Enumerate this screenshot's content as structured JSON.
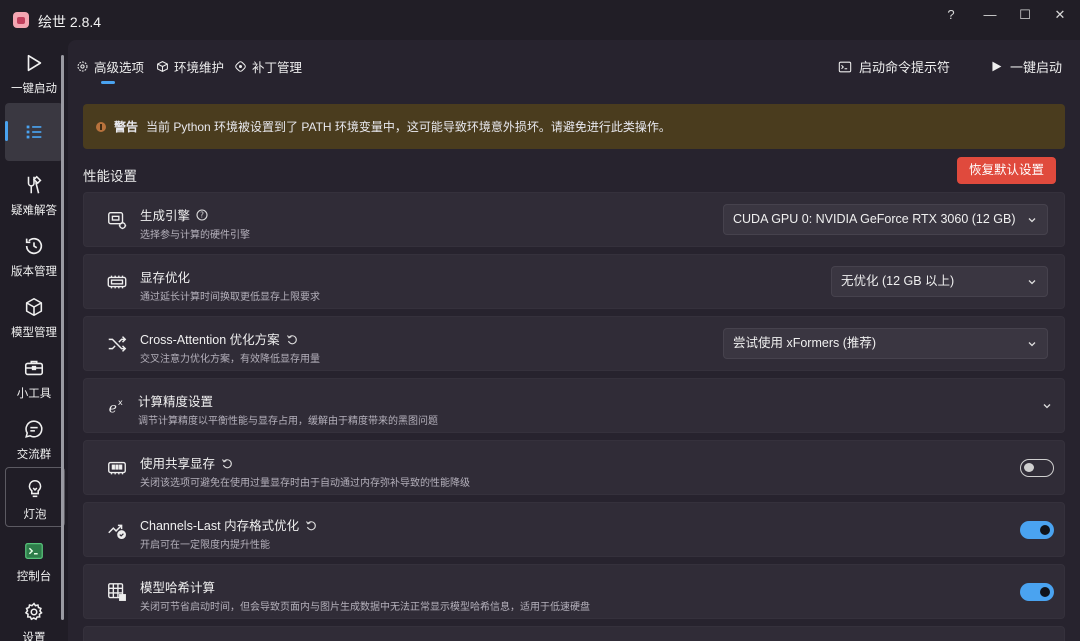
{
  "app": {
    "title": "绘世 2.8.4"
  },
  "window_controls": {
    "help": "?",
    "minimize": "—",
    "maximize": "☐",
    "close": "✕"
  },
  "sidebar": {
    "items": [
      {
        "label": "一键启动",
        "icon": "play-icon"
      },
      {
        "label": "",
        "icon": "list-icon"
      },
      {
        "label": "疑难解答",
        "icon": "tools-icon"
      },
      {
        "label": "版本管理",
        "icon": "history-icon"
      },
      {
        "label": "模型管理",
        "icon": "cube-icon"
      },
      {
        "label": "小工具",
        "icon": "toolbox-icon"
      },
      {
        "label": "交流群",
        "icon": "chat-icon"
      },
      {
        "label": "灯泡",
        "icon": "bulb-icon"
      },
      {
        "label": "控制台",
        "icon": "console-icon"
      },
      {
        "label": "设置",
        "icon": "gear-icon"
      }
    ]
  },
  "tabs": [
    {
      "label": "高级选项",
      "icon": "gear-icon"
    },
    {
      "label": "环境维护",
      "icon": "box-icon"
    },
    {
      "label": "补丁管理",
      "icon": "patch-icon"
    }
  ],
  "actions": {
    "console_label": "启动命令提示符",
    "launch_label": "一键启动"
  },
  "warning": {
    "label": "警告",
    "text": "当前 Python 环境被设置到了 PATH 环境变量中，这可能导致环境意外损坏。请避免进行此类操作。"
  },
  "section": {
    "title": "性能设置",
    "reset_label": "恢复默认设置"
  },
  "settings": [
    {
      "title": "生成引擎",
      "desc": "选择参与计算的硬件引擎",
      "control": "select",
      "value": "CUDA GPU 0: NVIDIA GeForce RTX 3060 (12 GB)",
      "icon": "engine-icon"
    },
    {
      "title": "显存优化",
      "desc": "通过延长计算时间换取更低显存上限要求",
      "control": "select",
      "value": "无优化 (12 GB 以上)",
      "icon": "memory-icon"
    },
    {
      "title": "Cross-Attention 优化方案",
      "desc": "交叉注意力优化方案，有效降低显存用量",
      "control": "select",
      "value": "尝试使用 xFormers (推荐)",
      "icon": "shuffle-icon"
    },
    {
      "title": "计算精度设置",
      "desc": "调节计算精度以平衡性能与显存占用，缓解由于精度带来的黑图问题",
      "control": "expand",
      "icon": "exponent-icon"
    },
    {
      "title": "使用共享显存",
      "desc": "关闭该选项可避免在使用过量显存时由于自动通过内存弥补导致的性能降级",
      "control": "toggle",
      "on": false,
      "icon": "ram-icon"
    },
    {
      "title": "Channels-Last 内存格式优化",
      "desc": "开启可在一定限度内提升性能",
      "control": "toggle",
      "on": true,
      "icon": "trend-icon"
    },
    {
      "title": "模型哈希计算",
      "desc": "关闭可节省启动时间，但会导致页面内与图片生成数据中无法正常显示模型哈希信息，适用于低速硬盘",
      "control": "toggle",
      "on": true,
      "icon": "table-icon"
    }
  ],
  "colors": {
    "accent": "#4aa3f0",
    "danger": "#e04a3d",
    "warning_bg": "#4a3c1e"
  }
}
